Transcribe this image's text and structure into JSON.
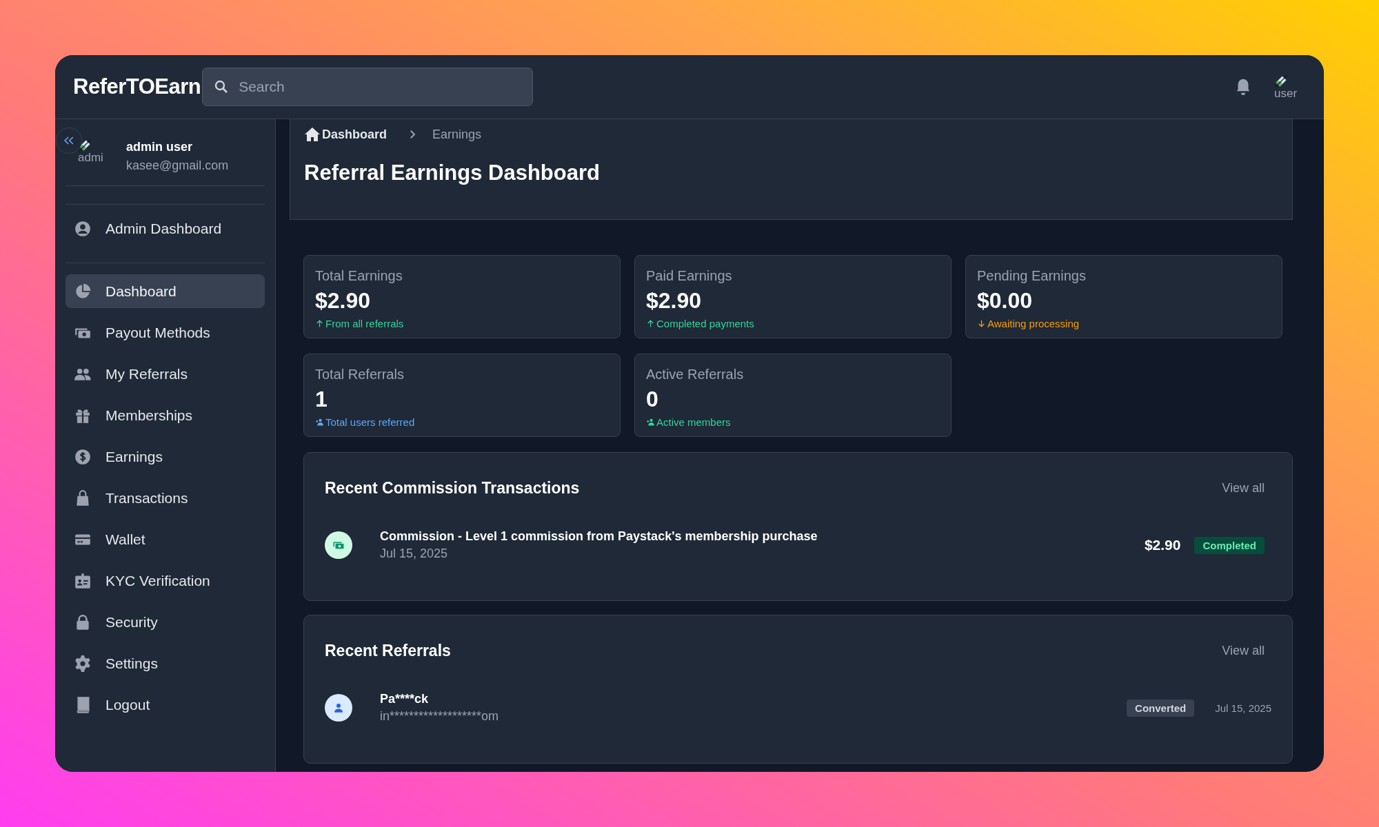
{
  "topbar": {
    "logo": "ReferTOEarn",
    "search": {
      "placeholder": "Search"
    },
    "avatar_alt": "user"
  },
  "sidebar": {
    "user": {
      "avatar_alt": "admi",
      "name": "admin user",
      "email": "kasee@gmail.com"
    },
    "admin_items": [
      {
        "label": "Admin Dashboard",
        "selected": false
      }
    ],
    "items": [
      {
        "label": "Dashboard",
        "selected": true
      },
      {
        "label": "Payout Methods",
        "selected": false
      },
      {
        "label": "My Referrals",
        "selected": false
      },
      {
        "label": "Memberships",
        "selected": false
      },
      {
        "label": "Earnings",
        "selected": false
      },
      {
        "label": "Transactions",
        "selected": false
      },
      {
        "label": "Wallet",
        "selected": false
      },
      {
        "label": "KYC Verification",
        "selected": false
      },
      {
        "label": "Security",
        "selected": false
      },
      {
        "label": "Settings",
        "selected": false
      },
      {
        "label": "Logout",
        "selected": false
      }
    ]
  },
  "breadcrumb": [
    {
      "label": "Dashboard"
    },
    {
      "label": "Earnings"
    }
  ],
  "page_title": "Referral Earnings Dashboard",
  "stats": [
    {
      "label": "Total Earnings",
      "value": "$2.90",
      "note": "From all referrals",
      "kind": "up",
      "color": "#34d399"
    },
    {
      "label": "Paid Earnings",
      "value": "$2.90",
      "note": "Completed payments",
      "kind": "up",
      "color": "#34d399"
    },
    {
      "label": "Pending Earnings",
      "value": "$0.00",
      "note": "Awaiting processing",
      "kind": "down",
      "color": "#f59e0b"
    },
    {
      "label": "Total Referrals",
      "value": "1",
      "note": "Total users referred",
      "kind": "users",
      "color": "#60a5fa"
    },
    {
      "label": "Active Referrals",
      "value": "0",
      "note": "Active members",
      "kind": "users",
      "color": "#34d399"
    }
  ],
  "transactions": {
    "title": "Recent Commission Transactions",
    "view_all": "View all",
    "items": [
      {
        "description": "Commission - Level 1 commission from Paystack's membership purchase",
        "date": "Jul 15, 2025",
        "amount": "$2.90",
        "status": "Completed"
      }
    ]
  },
  "referrals": {
    "title": "Recent Referrals",
    "view_all": "View all",
    "items": [
      {
        "name": "Pa****ck",
        "email": "in*******************om",
        "status": "Converted",
        "date": "Jul 15, 2025"
      }
    ]
  }
}
